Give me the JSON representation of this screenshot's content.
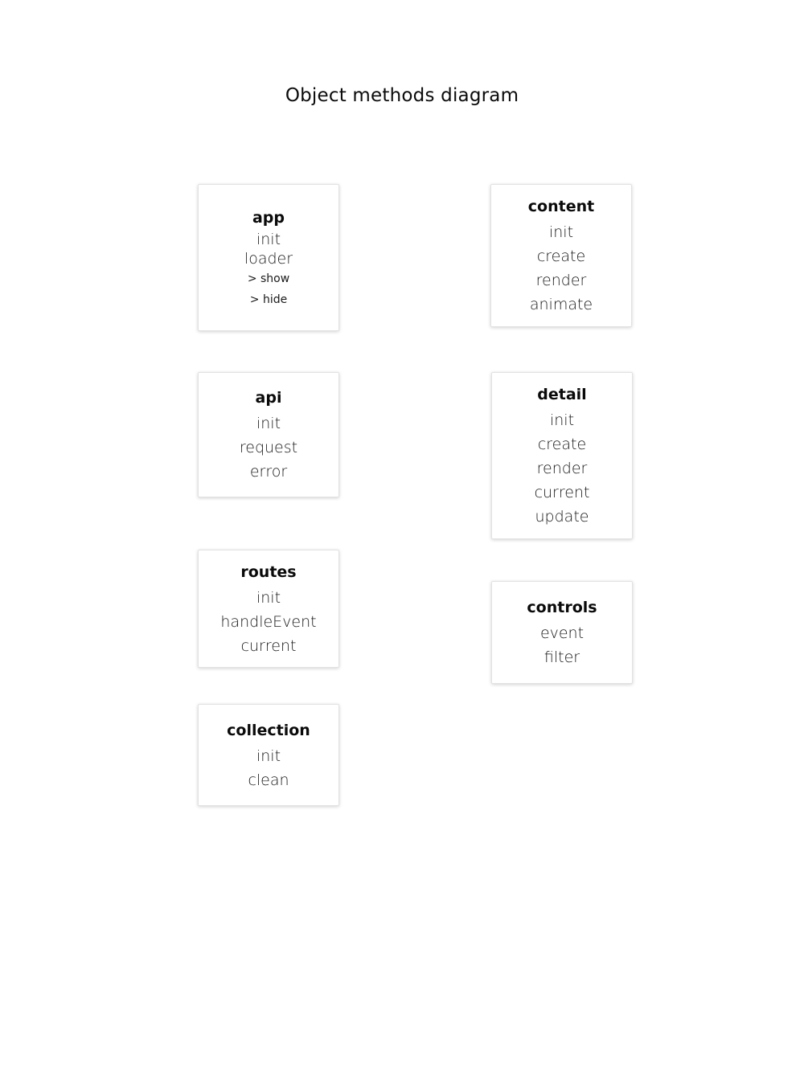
{
  "title": "Object methods diagram",
  "objects": {
    "app": {
      "name": "app",
      "methods": [
        "init",
        "loader"
      ],
      "submethods": [
        "> show",
        "> hide"
      ]
    },
    "api": {
      "name": "api",
      "methods": [
        "init",
        "request",
        "error"
      ]
    },
    "routes": {
      "name": "routes",
      "methods": [
        "init",
        "handleEvent",
        "current"
      ]
    },
    "collection": {
      "name": "collection",
      "methods": [
        "init",
        "clean"
      ]
    },
    "content": {
      "name": "content",
      "methods": [
        "init",
        "create",
        "render",
        "animate"
      ]
    },
    "detail": {
      "name": "detail",
      "methods": [
        "init",
        "create",
        "render",
        "current",
        "update"
      ]
    },
    "controls": {
      "name": "controls",
      "methods": [
        "event",
        "filter"
      ]
    }
  }
}
